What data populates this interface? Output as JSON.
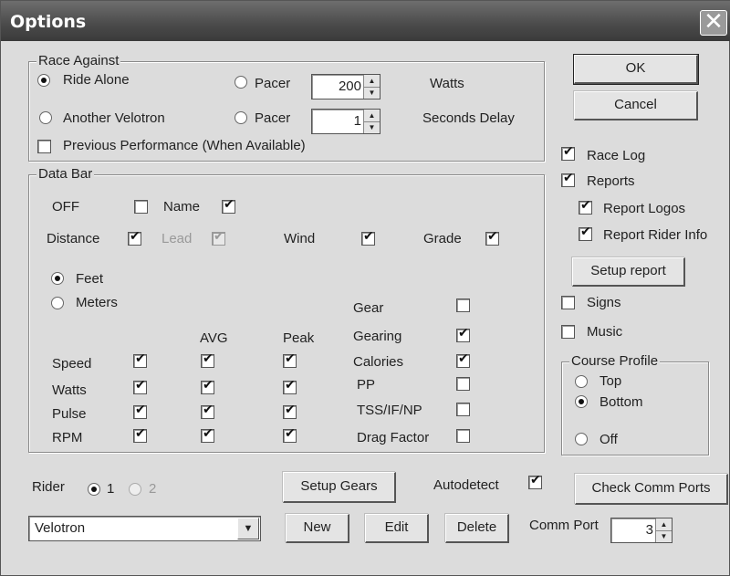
{
  "window": {
    "title": "Options",
    "close_glyph": "✕"
  },
  "race_against": {
    "legend": "Race Against",
    "ride_alone": "Ride Alone",
    "another_velotron": "Another Velotron",
    "pacer1_label": "Pacer",
    "pacer1_value": "200",
    "pacer1_unit": "Watts",
    "pacer2_label": "Pacer",
    "pacer2_value": "1",
    "pacer2_unit": "Seconds Delay",
    "previous_performance": "Previous Performance (When Available)"
  },
  "data_bar": {
    "legend": "Data Bar",
    "off": "OFF",
    "name": "Name",
    "distance": "Distance",
    "lead": "Lead",
    "wind": "Wind",
    "grade": "Grade",
    "feet": "Feet",
    "meters": "Meters",
    "avg": "AVG",
    "peak": "Peak",
    "speed": "Speed",
    "watts": "Watts",
    "pulse": "Pulse",
    "rpm": "RPM",
    "gear": "Gear",
    "gearing": "Gearing",
    "calories": "Calories",
    "pp": "PP",
    "tss": "TSS/IF/NP",
    "drag_factor": "Drag Factor"
  },
  "right_panel": {
    "ok": "OK",
    "cancel": "Cancel",
    "race_log": "Race Log",
    "reports": "Reports",
    "report_logos": "Report Logos",
    "report_rider_info": "Report Rider Info",
    "setup_report": "Setup report",
    "signs": "Signs",
    "music": "Music",
    "course_profile": "Course Profile",
    "top": "Top",
    "bottom": "Bottom",
    "off": "Off"
  },
  "bottom": {
    "rider": "Rider",
    "rider1": "1",
    "rider2": "2",
    "setup_gears": "Setup Gears",
    "autodetect": "Autodetect",
    "check_comm_ports": "Check Comm Ports",
    "rider_select": "Velotron",
    "new": "New",
    "edit": "Edit",
    "delete": "Delete",
    "comm_port": "Comm Port",
    "comm_port_value": "3"
  }
}
